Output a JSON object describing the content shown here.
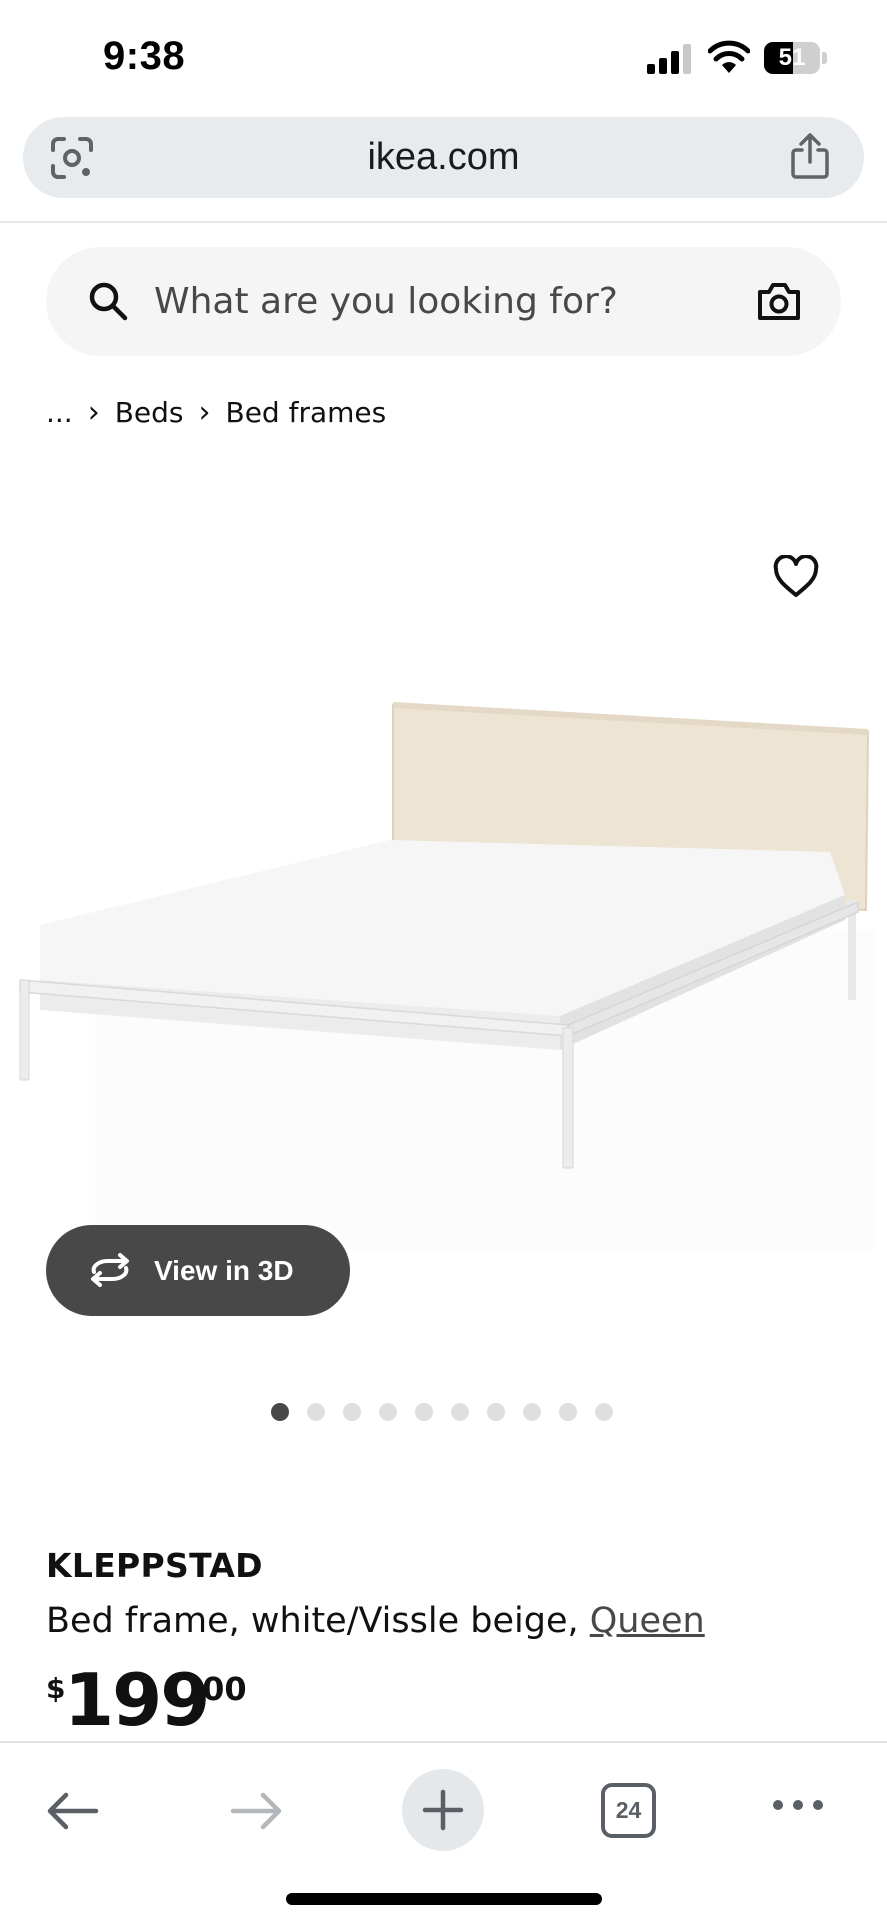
{
  "status_bar": {
    "time": "9:38",
    "battery_level": "51",
    "icons": [
      "cellular-signal-icon",
      "wifi-icon",
      "battery-icon"
    ]
  },
  "browser": {
    "url": "ikea.com",
    "icons": [
      "lens-icon",
      "share-icon"
    ]
  },
  "search": {
    "placeholder": "What are you looking for?",
    "icons": [
      "search-icon",
      "camera-icon"
    ]
  },
  "breadcrumb": {
    "items": [
      "...",
      "Beds",
      "Bed frames"
    ]
  },
  "gallery": {
    "view_3d_label": "View in 3D",
    "total_images": 10,
    "active_index": 0,
    "icons": [
      "heart-icon",
      "rotate-3d-icon"
    ]
  },
  "product": {
    "name": "KLEPPSTAD",
    "description": "Bed frame, white/Vissle beige, ",
    "size": "Queen",
    "price": {
      "currency": "$",
      "integer": "199",
      "decimal": ".00"
    }
  },
  "toolbar": {
    "tab_count": "24",
    "icons": [
      "back-arrow-icon",
      "forward-arrow-icon",
      "plus-icon",
      "tabs-icon",
      "more-icon"
    ]
  },
  "colors": {
    "accent_dark": "#484848",
    "url_bar_bg": "#e8ebee",
    "search_bg": "#f5f5f5",
    "headboard": "#ede4d3"
  }
}
